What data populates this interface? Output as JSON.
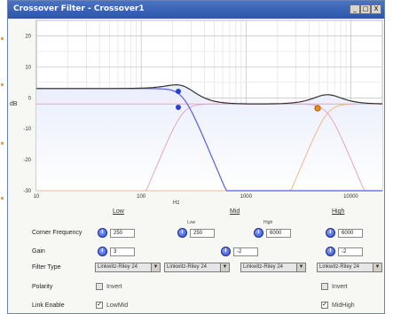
{
  "window": {
    "title": "Crossover Filter - Crossover1",
    "controls": {
      "minimize": "_",
      "maximize": "□",
      "close": "X"
    }
  },
  "graph": {
    "y_ticks": [
      "20",
      "10",
      "0",
      "-10",
      "-20",
      "-30"
    ],
    "y_label": "dB",
    "x_ticks": [
      "10",
      "100",
      "1000",
      "10000"
    ],
    "x_label": "Hz",
    "colors": {
      "low": "#5562d8",
      "lowmid_tail": "#e3a7c6",
      "high": "#f0b88a",
      "sum": "#333333",
      "fill_top": "#e9eefb",
      "fill_bottom": "#ffffff",
      "handle_blue": "#2a3fd1",
      "handle_orange": "#f08a1c"
    }
  },
  "bands": {
    "low": "Low",
    "mid": "Mid",
    "high": "High"
  },
  "controls": {
    "corner_frequency": {
      "label": "Corner Frequency",
      "low_head": "Low",
      "high_head": "High",
      "values": [
        "250",
        "250",
        "6000",
        "6000"
      ]
    },
    "gain": {
      "label": "Gain",
      "values": [
        "3",
        "-2",
        "-2"
      ]
    },
    "filter_type": {
      "label": "Filter Type",
      "values": [
        "Linkwitz-Riley 24",
        "Linkwitz-Riley 24",
        "Linkwitz-Riley 24",
        "Linkwitz-Riley 24"
      ]
    },
    "polarity": {
      "label": "Polarity",
      "left_check": "Invert",
      "right_check": "Invert"
    },
    "link_enable": {
      "label": "Link Enable",
      "left_check": "LowMid",
      "right_check": "MidHigh"
    }
  }
}
